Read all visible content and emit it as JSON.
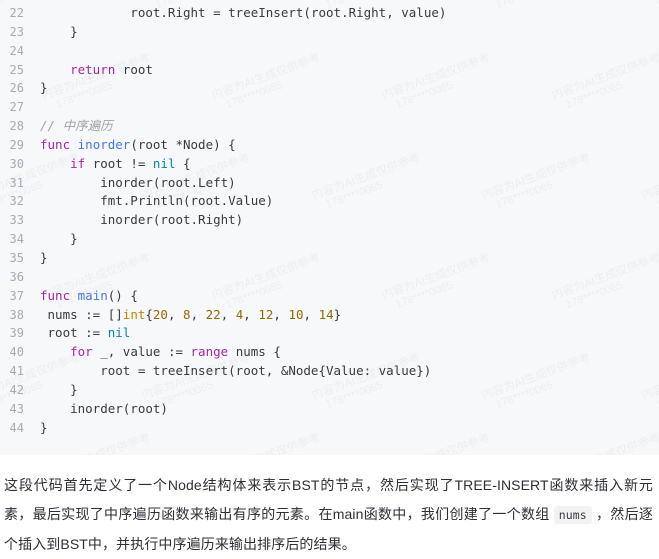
{
  "code_block": {
    "language": "go",
    "background": "#f7f8fa",
    "line_number_color": "#a6aab5",
    "first_line_number": 22,
    "last_line_number": 44,
    "lines": [
      {
        "number": "22",
        "tokens": [
          {
            "t": "            root.Right = ",
            "c": "pl"
          },
          {
            "t": "treeInsert",
            "c": "pl"
          },
          {
            "t": "(root.Right, value)",
            "c": "pl"
          }
        ]
      },
      {
        "number": "23",
        "tokens": [
          {
            "t": "    }",
            "c": "pl"
          }
        ]
      },
      {
        "number": "24",
        "tokens": [
          {
            "t": "",
            "c": "pl"
          }
        ]
      },
      {
        "number": "25",
        "tokens": [
          {
            "t": "    ",
            "c": "pl"
          },
          {
            "t": "return",
            "c": "kw"
          },
          {
            "t": " root",
            "c": "pl"
          }
        ]
      },
      {
        "number": "26",
        "tokens": [
          {
            "t": "}",
            "c": "pl"
          }
        ]
      },
      {
        "number": "27",
        "tokens": [
          {
            "t": "",
            "c": "pl"
          }
        ]
      },
      {
        "number": "28",
        "tokens": [
          {
            "t": "// 中序遍历",
            "c": "cmt"
          }
        ]
      },
      {
        "number": "29",
        "tokens": [
          {
            "t": "func",
            "c": "kw"
          },
          {
            "t": " ",
            "c": "pl"
          },
          {
            "t": "inorder",
            "c": "fn"
          },
          {
            "t": "(root *Node) {",
            "c": "pl"
          }
        ]
      },
      {
        "number": "30",
        "tokens": [
          {
            "t": "    ",
            "c": "pl"
          },
          {
            "t": "if",
            "c": "kw"
          },
          {
            "t": " root != ",
            "c": "pl"
          },
          {
            "t": "nil",
            "c": "nil"
          },
          {
            "t": " {",
            "c": "pl"
          }
        ]
      },
      {
        "number": "31",
        "tokens": [
          {
            "t": "        inorder(root.Left)",
            "c": "pl"
          }
        ]
      },
      {
        "number": "32",
        "tokens": [
          {
            "t": "        fmt.Println(root.Value)",
            "c": "pl"
          }
        ]
      },
      {
        "number": "33",
        "tokens": [
          {
            "t": "        inorder(root.Right)",
            "c": "pl"
          }
        ]
      },
      {
        "number": "34",
        "tokens": [
          {
            "t": "    }",
            "c": "pl"
          }
        ]
      },
      {
        "number": "35",
        "tokens": [
          {
            "t": "}",
            "c": "pl"
          }
        ]
      },
      {
        "number": "36",
        "tokens": [
          {
            "t": "",
            "c": "pl"
          }
        ]
      },
      {
        "number": "37",
        "tokens": [
          {
            "t": "func",
            "c": "kw"
          },
          {
            "t": " ",
            "c": "pl"
          },
          {
            "t": "main",
            "c": "fn"
          },
          {
            "t": "() {",
            "c": "pl"
          }
        ]
      },
      {
        "number": "38",
        "tokens": [
          {
            "t": " nums := []",
            "c": "pl"
          },
          {
            "t": "int",
            "c": "typ"
          },
          {
            "t": "{",
            "c": "pl"
          },
          {
            "t": "20",
            "c": "num"
          },
          {
            "t": ", ",
            "c": "pl"
          },
          {
            "t": "8",
            "c": "num"
          },
          {
            "t": ", ",
            "c": "pl"
          },
          {
            "t": "22",
            "c": "num"
          },
          {
            "t": ", ",
            "c": "pl"
          },
          {
            "t": "4",
            "c": "num"
          },
          {
            "t": ", ",
            "c": "pl"
          },
          {
            "t": "12",
            "c": "num"
          },
          {
            "t": ", ",
            "c": "pl"
          },
          {
            "t": "10",
            "c": "num"
          },
          {
            "t": ", ",
            "c": "pl"
          },
          {
            "t": "14",
            "c": "num"
          },
          {
            "t": "}",
            "c": "pl"
          }
        ]
      },
      {
        "number": "39",
        "tokens": [
          {
            "t": " root := ",
            "c": "pl"
          },
          {
            "t": "nil",
            "c": "nil"
          }
        ]
      },
      {
        "number": "40",
        "tokens": [
          {
            "t": "    ",
            "c": "pl"
          },
          {
            "t": "for",
            "c": "kw"
          },
          {
            "t": " _, value := ",
            "c": "pl"
          },
          {
            "t": "range",
            "c": "kw"
          },
          {
            "t": " nums {",
            "c": "pl"
          }
        ]
      },
      {
        "number": "41",
        "tokens": [
          {
            "t": "        root = treeInsert(root, &Node{Value: value})",
            "c": "pl"
          }
        ]
      },
      {
        "number": "42",
        "tokens": [
          {
            "t": "    }",
            "c": "pl"
          }
        ]
      },
      {
        "number": "43",
        "tokens": [
          {
            "t": "    inorder(root)",
            "c": "pl"
          }
        ]
      },
      {
        "number": "44",
        "tokens": [
          {
            "t": "}",
            "c": "pl"
          }
        ]
      }
    ]
  },
  "watermark": {
    "line1": "内容为AI生成仅供参考",
    "line2": "178****0065"
  },
  "paragraph": {
    "part1": "这段代码首先定义了一个Node结构体来表示BST的节点，然后实现了TREE-INSERT函数来插入新元素，最后实现了中序遍历函数来输出有序的元素。在main函数中，我们创建了一个数组 ",
    "inline_code": "nums",
    "part2": " ，然后逐个插入到BST中，并执行中序遍历来输出排序后的结果。"
  }
}
